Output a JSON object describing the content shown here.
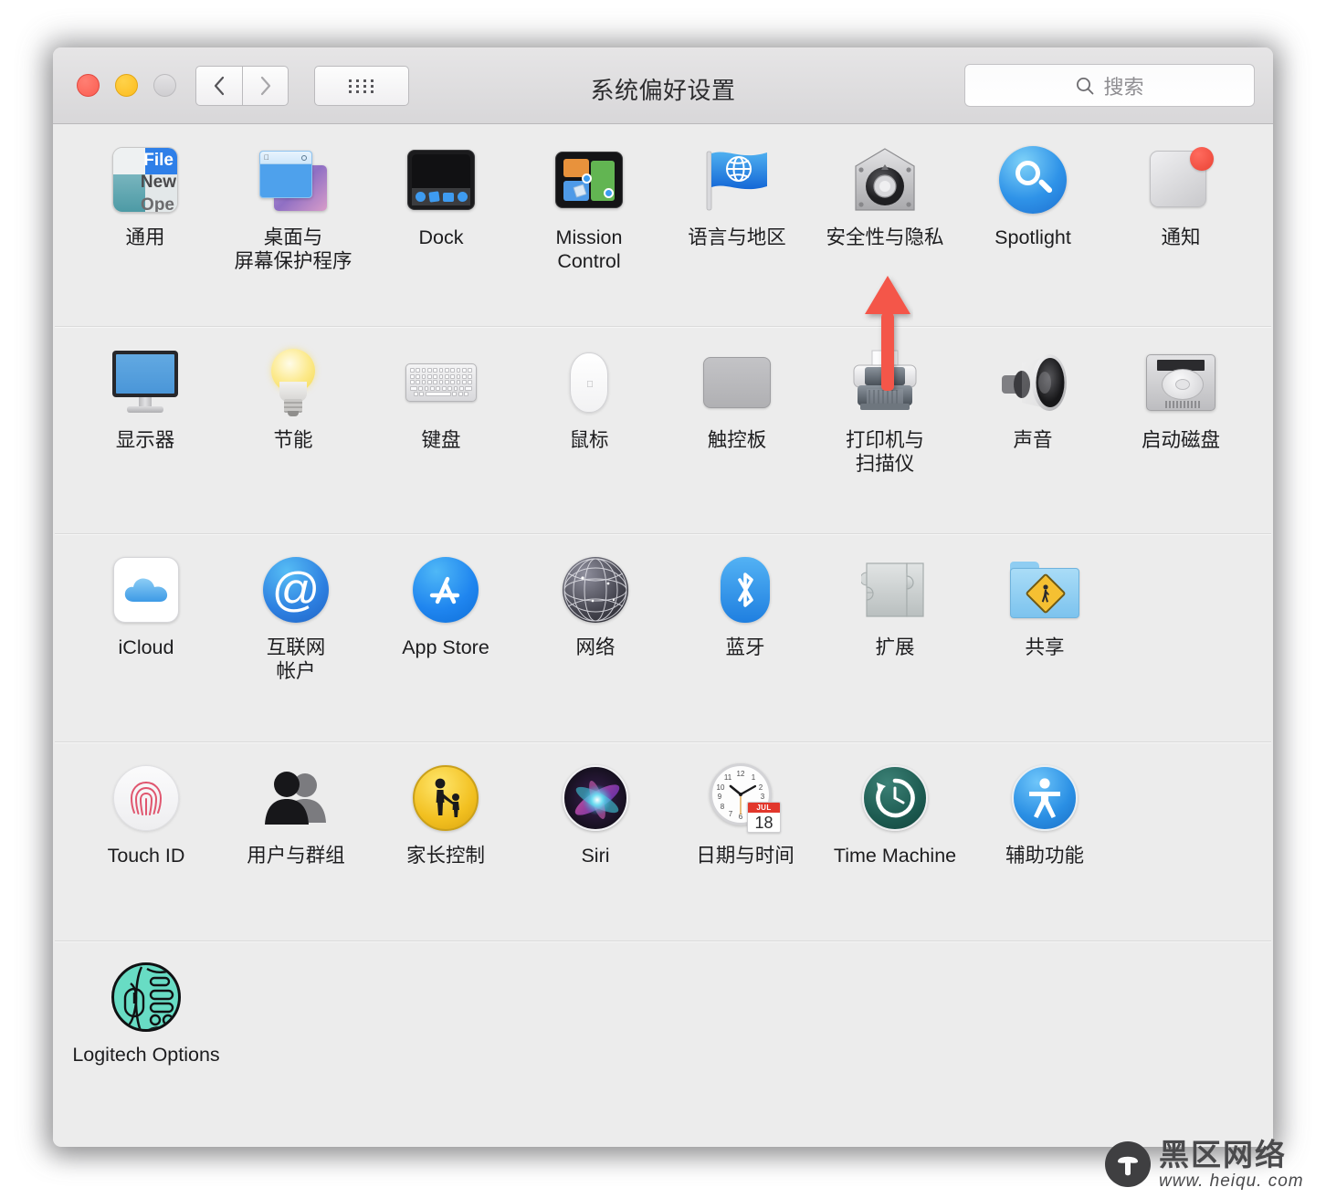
{
  "window": {
    "title": "系统偏好设置",
    "traffic_lights": [
      "close",
      "minimize",
      "zoom"
    ],
    "nav": {
      "back_label": "‹",
      "forward_label": "›"
    },
    "grid_button": "show-all-grid",
    "search": {
      "placeholder": "搜索",
      "value": ""
    }
  },
  "annotation": {
    "arrow_color": "#f4564a",
    "points_to": "安全性与隐私"
  },
  "rows": [
    {
      "id": "row-personal",
      "items": [
        {
          "name": "general",
          "label": "通用",
          "icon": "general-icon"
        },
        {
          "name": "desktop",
          "label": "桌面与\n屏幕保护程序",
          "icon": "desktop-screensaver-icon"
        },
        {
          "name": "dock",
          "label": "Dock",
          "icon": "dock-icon"
        },
        {
          "name": "mission-control",
          "label": "Mission\nControl",
          "icon": "mission-control-icon"
        },
        {
          "name": "language",
          "label": "语言与地区",
          "icon": "language-region-flag-icon"
        },
        {
          "name": "security",
          "label": "安全性与隐私",
          "icon": "security-privacy-safe-icon"
        },
        {
          "name": "spotlight",
          "label": "Spotlight",
          "icon": "spotlight-magnifier-icon"
        },
        {
          "name": "notifications",
          "label": "通知",
          "icon": "notifications-icon"
        }
      ]
    },
    {
      "id": "row-hardware",
      "items": [
        {
          "name": "displays",
          "label": "显示器",
          "icon": "display-monitor-icon"
        },
        {
          "name": "energy",
          "label": "节能",
          "icon": "lightbulb-icon"
        },
        {
          "name": "keyboard",
          "label": "键盘",
          "icon": "keyboard-icon"
        },
        {
          "name": "mouse",
          "label": "鼠标",
          "icon": "mouse-icon"
        },
        {
          "name": "trackpad",
          "label": "触控板",
          "icon": "trackpad-icon"
        },
        {
          "name": "printers",
          "label": "打印机与\n扫描仪",
          "icon": "printer-icon"
        },
        {
          "name": "sound",
          "label": "声音",
          "icon": "speaker-icon"
        },
        {
          "name": "startupdisk",
          "label": "启动磁盘",
          "icon": "hard-disk-icon"
        }
      ]
    },
    {
      "id": "row-internet",
      "items": [
        {
          "name": "icloud",
          "label": "iCloud",
          "icon": "icloud-cloud-icon"
        },
        {
          "name": "accounts",
          "label": "互联网\n帐户",
          "icon": "at-sign-icon"
        },
        {
          "name": "appstore",
          "label": "App Store",
          "icon": "app-store-icon"
        },
        {
          "name": "network",
          "label": "网络",
          "icon": "globe-network-icon"
        },
        {
          "name": "bluetooth",
          "label": "蓝牙",
          "icon": "bluetooth-icon"
        },
        {
          "name": "extensions",
          "label": "扩展",
          "icon": "puzzle-piece-icon"
        },
        {
          "name": "sharing",
          "label": "共享",
          "icon": "sharing-folder-icon"
        }
      ]
    },
    {
      "id": "row-system",
      "items": [
        {
          "name": "touchid",
          "label": "Touch ID",
          "icon": "fingerprint-icon"
        },
        {
          "name": "users",
          "label": "用户与群组",
          "icon": "users-groups-icon"
        },
        {
          "name": "parental",
          "label": "家长控制",
          "icon": "parental-controls-icon"
        },
        {
          "name": "siri",
          "label": "Siri",
          "icon": "siri-orb-icon"
        },
        {
          "name": "datetime",
          "label": "日期与时间",
          "icon": "clock-calendar-icon",
          "calendar": {
            "month": "JUL",
            "day": "18"
          }
        },
        {
          "name": "timemachine",
          "label": "Time Machine",
          "icon": "time-machine-icon"
        },
        {
          "name": "accessibility",
          "label": "辅助功能",
          "icon": "accessibility-icon"
        }
      ]
    },
    {
      "id": "row-other",
      "items": [
        {
          "name": "logitech-options",
          "label": "Logitech Options",
          "icon": "logitech-options-icon"
        }
      ]
    }
  ],
  "watermark": {
    "site_name": "黑区网络",
    "url": "www. heiqu. com"
  }
}
